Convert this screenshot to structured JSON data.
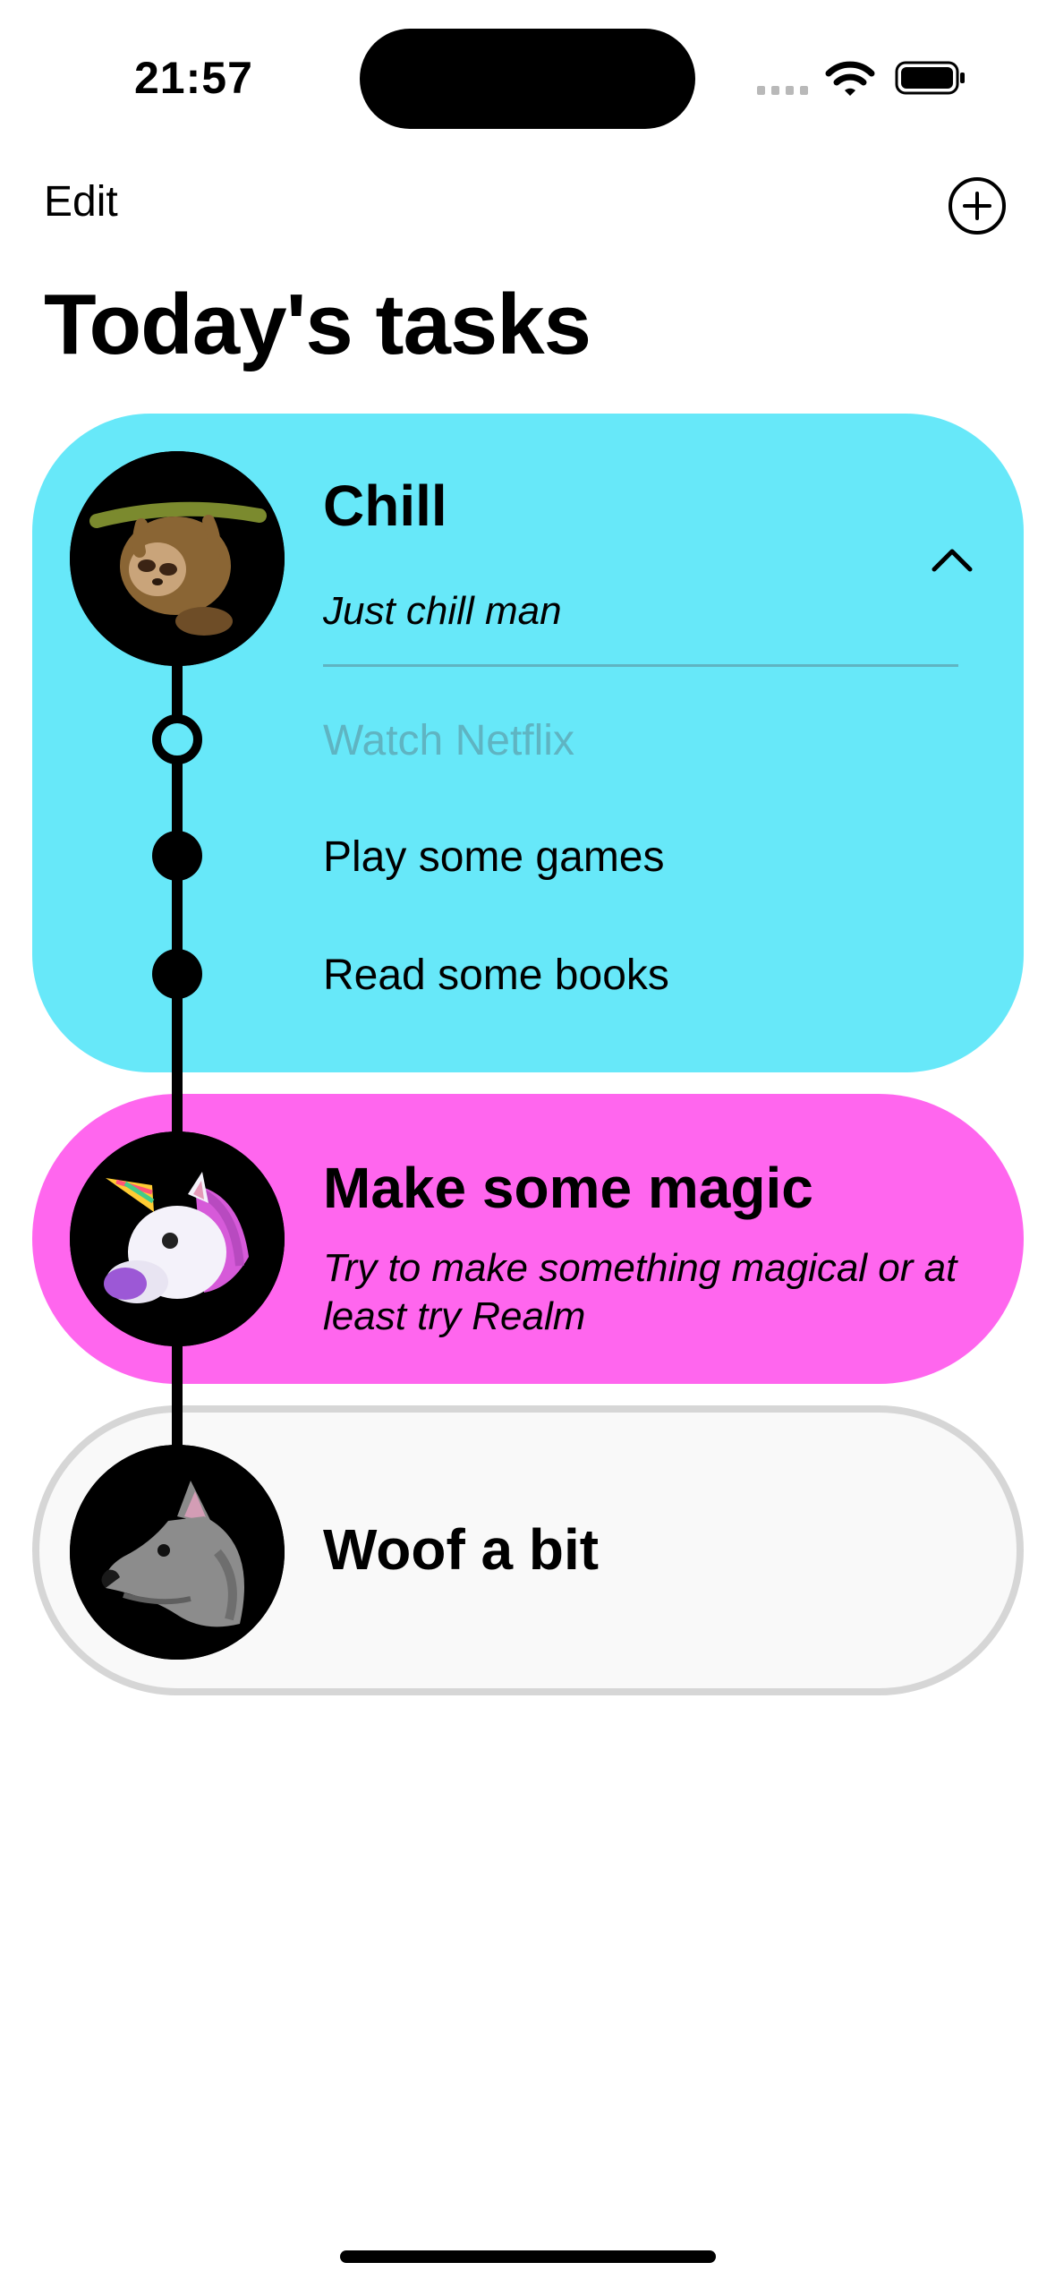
{
  "status_bar": {
    "time": "21:57"
  },
  "nav": {
    "edit_label": "Edit"
  },
  "page_title": "Today's tasks",
  "tasks": [
    {
      "title": "Chill",
      "subtitle": "Just chill man",
      "color": "#67e8f9",
      "avatar_icon": "sloth-icon",
      "expanded": true,
      "subtasks": [
        {
          "label": "Watch Netflix",
          "done": false
        },
        {
          "label": "Play some games",
          "done": true
        },
        {
          "label": "Read some books",
          "done": true
        }
      ]
    },
    {
      "title": "Make some magic",
      "subtitle": "Try to make something magical or at least try Realm",
      "color": "#ff66ee",
      "avatar_icon": "unicorn-icon"
    },
    {
      "title": "Woof a bit",
      "color": "#f9f9f9",
      "avatar_icon": "wolf-icon"
    }
  ]
}
